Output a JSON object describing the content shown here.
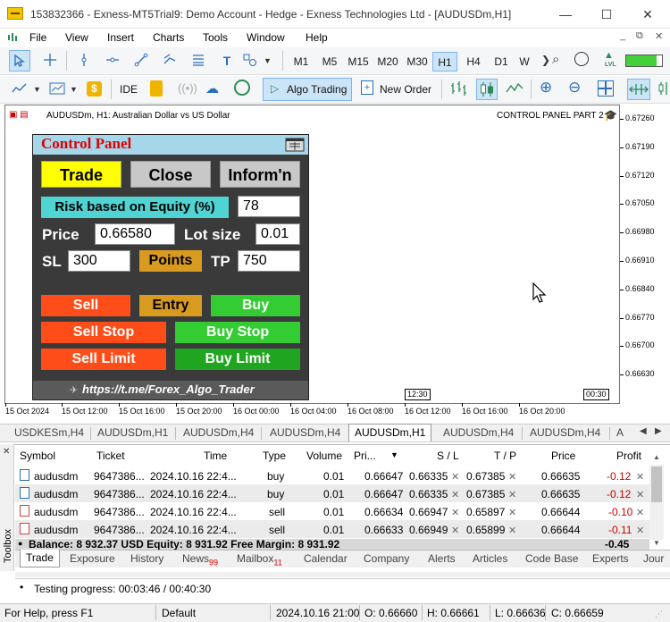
{
  "window": {
    "title": "153832366 - Exness-MT5Trial9: Demo Account - Hedge - Exness Technologies Ltd - [AUDUSDm,H1]",
    "minimize": "—",
    "maximize": "☐",
    "close": "✕"
  },
  "menu": {
    "items": [
      "File",
      "View",
      "Insert",
      "Charts",
      "Tools",
      "Window",
      "Help"
    ],
    "right_controls": [
      "_",
      "⧉",
      "✕"
    ]
  },
  "toolbar": {
    "timeframes": [
      "M1",
      "M5",
      "M15",
      "M20",
      "M30",
      "H1",
      "H4",
      "D1",
      "W"
    ],
    "active_timeframe": "H1",
    "ide_label": "IDE",
    "algo_trading_label": "Algo Trading",
    "new_order_label": "New Order",
    "lvl_label": "LVL"
  },
  "chart": {
    "title": "AUDUSDm, H1:  Australian Dollar vs US Dollar",
    "panel_label": "CONTROL PANEL PART 2",
    "price_labels": [
      "0.67260",
      "0.67190",
      "0.67120",
      "0.67050",
      "0.66980",
      "0.66910",
      "0.66840",
      "0.66770",
      "0.66700",
      "0.66630"
    ],
    "time_labels": [
      "15 Oct 2024",
      "15 Oct 12:00",
      "15 Oct 16:00",
      "15 Oct 20:00",
      "16 Oct 00:00",
      "16 Oct 04:00",
      "16 Oct 08:00",
      "16 Oct 12:00",
      "16 Oct 16:00",
      "16 Oct 20:00"
    ],
    "time_box_1": "12:30",
    "time_box_2": "00:30"
  },
  "control_panel": {
    "title": "Control Panel",
    "tabs": {
      "trade": "Trade",
      "close": "Close",
      "inform": "Inform'n"
    },
    "risk_label": "Risk based on Equity (%)",
    "risk_value": "78",
    "price_label": "Price",
    "price_value": "0.66580",
    "lot_label": "Lot size",
    "lot_value": "0.01",
    "sl_label": "SL",
    "sl_value": "300",
    "points_label": "Points",
    "tp_label": "TP",
    "tp_value": "750",
    "sell": "Sell",
    "entry": "Entry",
    "buy": "Buy",
    "sell_stop": "Sell Stop",
    "buy_stop": "Buy Stop",
    "sell_limit": "Sell Limit",
    "buy_limit": "Buy Limit",
    "link": "https://t.me/Forex_Algo_Trader",
    "colors": {
      "trade": "#ffff00",
      "info_bg": "#4fd3d3",
      "sell": "#ff4d1a",
      "buy": "#33cc33",
      "entry": "#d99a20",
      "buy_limit": "#1fa51f"
    }
  },
  "chart_tabs": {
    "tabs": [
      "USDKESm,H4",
      "AUDUSDm,H1",
      "AUDUSDm,H4",
      "AUDUSDm,H4",
      "AUDUSDm,H1",
      "AUDUSDm,H4",
      "AUDUSDm,H4",
      "A"
    ],
    "active_index": 4
  },
  "positions": {
    "columns": [
      "Symbol",
      "Ticket",
      "Time",
      "Type",
      "Volume",
      "Pri...",
      "S / L",
      "T / P",
      "Price",
      "Profit"
    ],
    "rows": [
      {
        "symbol": "audusdm",
        "ticket": "9647386...",
        "time": "2024.10.16 22:4...",
        "type": "buy",
        "volume": "0.01",
        "open": "0.66647",
        "sl": "0.66335",
        "tp": "0.67385",
        "price": "0.66635",
        "profit": "-0.12"
      },
      {
        "symbol": "audusdm",
        "ticket": "9647386...",
        "time": "2024.10.16 22:4...",
        "type": "buy",
        "volume": "0.01",
        "open": "0.66647",
        "sl": "0.66335",
        "tp": "0.67385",
        "price": "0.66635",
        "profit": "-0.12"
      },
      {
        "symbol": "audusdm",
        "ticket": "9647386...",
        "time": "2024.10.16 22:4...",
        "type": "sell",
        "volume": "0.01",
        "open": "0.66634",
        "sl": "0.66947",
        "tp": "0.65897",
        "price": "0.66644",
        "profit": "-0.10"
      },
      {
        "symbol": "audusdm",
        "ticket": "9647386...",
        "time": "2024.10.16 22:4...",
        "type": "sell",
        "volume": "0.01",
        "open": "0.66633",
        "sl": "0.66949",
        "tp": "0.65899",
        "price": "0.66644",
        "profit": "-0.11"
      }
    ],
    "balance_line": "Balance: 8 932.37 USD  Equity: 8 931.92  Free Margin: 8 931.92",
    "total_profit": "-0.45"
  },
  "toolbox": {
    "label": "Toolbox",
    "tabs": [
      "Trade",
      "Exposure",
      "History",
      "News",
      "Mailbox",
      "Calendar",
      "Company",
      "Alerts",
      "Articles",
      "Code Base",
      "Experts",
      "Jour"
    ],
    "news_badge": "99",
    "mailbox_badge": "11"
  },
  "log": {
    "line": "Testing progress: 00:03:46 / 00:40:30"
  },
  "status": {
    "help": "For Help, press F1",
    "profile": "Default",
    "datetime": "2024.10.16 21:00",
    "open": "O: 0.66660",
    "high": "H: 0.66661",
    "low": "L: 0.66636",
    "close": "C: 0.66659"
  }
}
